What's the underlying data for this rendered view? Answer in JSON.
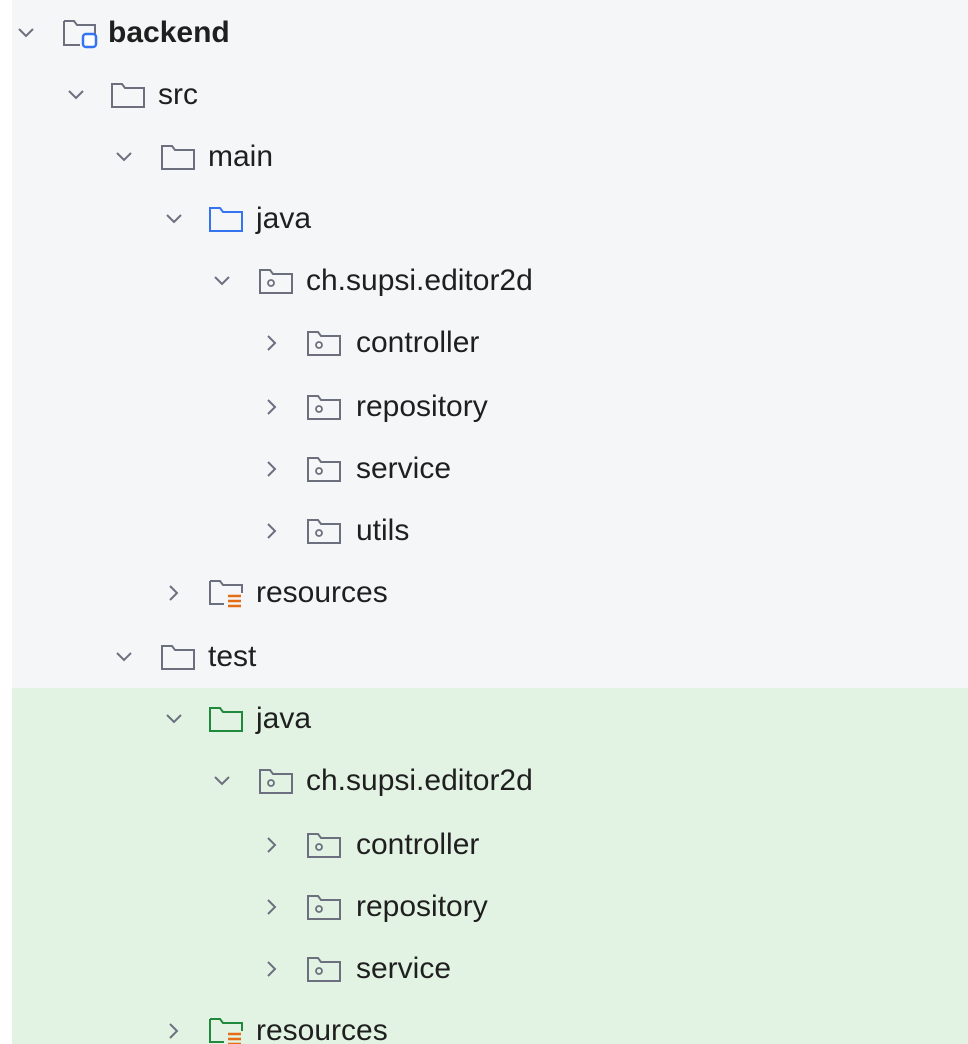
{
  "tree": {
    "root": {
      "label": "backend",
      "icon": "module-folder-icon",
      "expanded": true
    },
    "src": {
      "label": "src",
      "icon": "folder-icon",
      "expanded": true
    },
    "main": {
      "label": "main",
      "icon": "folder-icon",
      "expanded": true
    },
    "main_java": {
      "label": "java",
      "icon": "source-root-folder-icon",
      "expanded": true
    },
    "main_pkg": {
      "label": "ch.supsi.editor2d",
      "icon": "package-icon",
      "expanded": true
    },
    "main_pkg_controller": {
      "label": "controller",
      "icon": "package-icon",
      "expanded": false
    },
    "main_pkg_repository": {
      "label": "repository",
      "icon": "package-icon",
      "expanded": false
    },
    "main_pkg_service": {
      "label": "service",
      "icon": "package-icon",
      "expanded": false
    },
    "main_pkg_utils": {
      "label": "utils",
      "icon": "package-icon",
      "expanded": false
    },
    "main_resources": {
      "label": "resources",
      "icon": "resources-folder-icon",
      "expanded": false
    },
    "test": {
      "label": "test",
      "icon": "folder-icon",
      "expanded": true
    },
    "test_java": {
      "label": "java",
      "icon": "test-source-root-folder-icon",
      "expanded": true
    },
    "test_pkg": {
      "label": "ch.supsi.editor2d",
      "icon": "package-icon",
      "expanded": true
    },
    "test_pkg_controller": {
      "label": "controller",
      "icon": "package-icon",
      "expanded": false
    },
    "test_pkg_repository": {
      "label": "repository",
      "icon": "package-icon",
      "expanded": false
    },
    "test_pkg_service": {
      "label": "service",
      "icon": "package-icon",
      "expanded": false
    },
    "test_resources": {
      "label": "resources",
      "icon": "test-resources-folder-icon",
      "expanded": false
    }
  },
  "colors": {
    "panel_bg": "#f5f6f8",
    "selection_bg": "#e2f3e3",
    "folder_stroke": "#6c707e",
    "source_root": "#3574f0",
    "test_root": "#208a3c",
    "resources_accent": "#e66d17",
    "text": "#1f1f1f"
  }
}
